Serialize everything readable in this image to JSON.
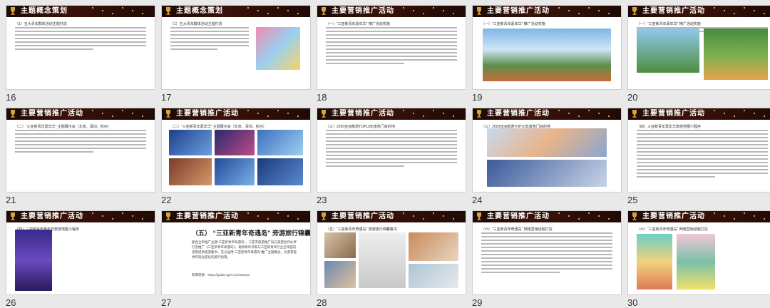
{
  "slides": [
    {
      "num": "16",
      "title": "主题概念策划",
      "subtitle": "（1）五大青年群体活动主题打造",
      "body_lines": 7,
      "images": []
    },
    {
      "num": "17",
      "title": "主题概念策划",
      "subtitle": "（1）五大青年群体活动主题打造",
      "body_lines": 7,
      "images": [
        "mascot"
      ]
    },
    {
      "num": "18",
      "title": "主要营销推广活动",
      "subtitle": "（一）“三亚新青年嘉年华” 推广活动实施",
      "body_lines": 11,
      "images": []
    },
    {
      "num": "19",
      "title": "主要营销推广活动",
      "subtitle": "（一）“三亚新青年嘉年华” 推广活动实施",
      "body_lines": 0,
      "images": [
        "photo-wide"
      ]
    },
    {
      "num": "20",
      "title": "主要营销推广活动",
      "subtitle": "（一）“三亚新青年嘉年华” 推广活动实施",
      "body_lines": 2,
      "images": [
        "photo-pair"
      ]
    },
    {
      "num": "21",
      "title": "主要营销推广活动",
      "subtitle": "（二）“三亚新青年嘉年华” 主题展示会（北京、深圳、杭州）",
      "body_lines": 7,
      "images": []
    },
    {
      "num": "22",
      "title": "主要营销推广活动",
      "subtitle": "（二）“三亚新青年嘉年华” 主题展示会（北京、深圳、杭州）",
      "body_lines": 0,
      "images": [
        "photo-grid"
      ]
    },
    {
      "num": "23",
      "title": "主要营销推广活动",
      "subtitle": "（三）2020亚洲旅游TOP10年度热门目的地",
      "body_lines": 11,
      "images": []
    },
    {
      "num": "24",
      "title": "主要营销推广活动",
      "subtitle": "（三）2020亚洲旅游TOP10年度热门目的地",
      "body_lines": 0,
      "images": [
        "photo-pair2"
      ]
    },
    {
      "num": "25",
      "title": "主要营销推广活动",
      "subtitle": "（四）三亚新青年嘉年华旅游地图小程序",
      "body_lines": 14,
      "images": []
    },
    {
      "num": "26",
      "title": "主要营销推广活动",
      "subtitle": "（四）三亚新青年嘉年华旅游地图小程序",
      "body_lines": 0,
      "images": [
        "phone-screens"
      ]
    },
    {
      "num": "27",
      "title": "主要营销推广活动",
      "subtitle": "（五）“三亚新青年奇遇岛” 旁游旅行锦囊路书",
      "body_lines": 0,
      "images": []
    },
    {
      "num": "28",
      "title": "主要营销推广活动",
      "subtitle": "（五）“三亚新青年奇遇岛” 旅游旅行锦囊路书",
      "body_lines": 0,
      "images": [
        "book-pages"
      ]
    },
    {
      "num": "29",
      "title": "主要营销推广活动",
      "subtitle": "（六）“三亚新青年奇遇岛” 网络营销话题打造",
      "body_lines": 12,
      "images": []
    },
    {
      "num": "30",
      "title": "主要营销推广活动",
      "subtitle": "（六）“三亚新青年奇遇岛” 网络营销话题打造",
      "body_lines": 0,
      "images": [
        "posters"
      ]
    }
  ],
  "slide27": {
    "heading": "（五） “三亚新青年奇遇岛” 旁游旅行锦囊路书",
    "para": "配合全年推广主题“三亚新青年奇遇岛”，三亚市旅游推广局与旅游合作伙伴打造推广《三亚新青年奇遇岛》，邀请青年作家与三亚新青年行业全年面向游客提供旅游路书，充分运用“三亚新青年奇遇岛”推广主题概念，为游客提供年轻化度化的旅行指南。",
    "link": "和来链接：https://guide.qyer.com/sanya/"
  }
}
